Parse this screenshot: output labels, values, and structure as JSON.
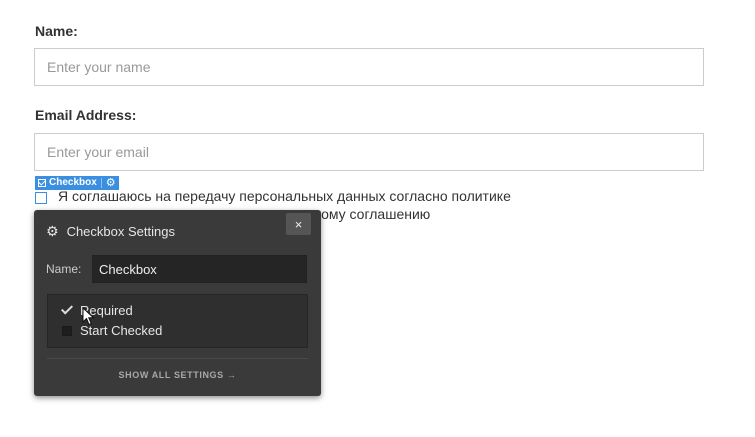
{
  "form": {
    "name_label": "Name:",
    "name_placeholder": "Enter your name",
    "email_label": "Email Address:",
    "email_placeholder": "Enter your email",
    "agreement_line1": "Я соглашаюсь на передачу персональных данных согласно политике",
    "agreement_line2_visible": "ельскому соглашению"
  },
  "element_tag": {
    "label": "Checkbox",
    "icons": [
      "checkbox-icon",
      "gear-icon"
    ],
    "color": "#3b8fe0"
  },
  "settings_panel": {
    "title": "Checkbox Settings",
    "close_label": "×",
    "name_field_label": "Name:",
    "name_field_value": "Checkbox",
    "options": [
      {
        "label": "Required",
        "checked": true
      },
      {
        "label": "Start Checked",
        "checked": false
      }
    ],
    "show_all_label": "SHOW ALL SETTINGS →",
    "background": "#3a3a3a"
  }
}
